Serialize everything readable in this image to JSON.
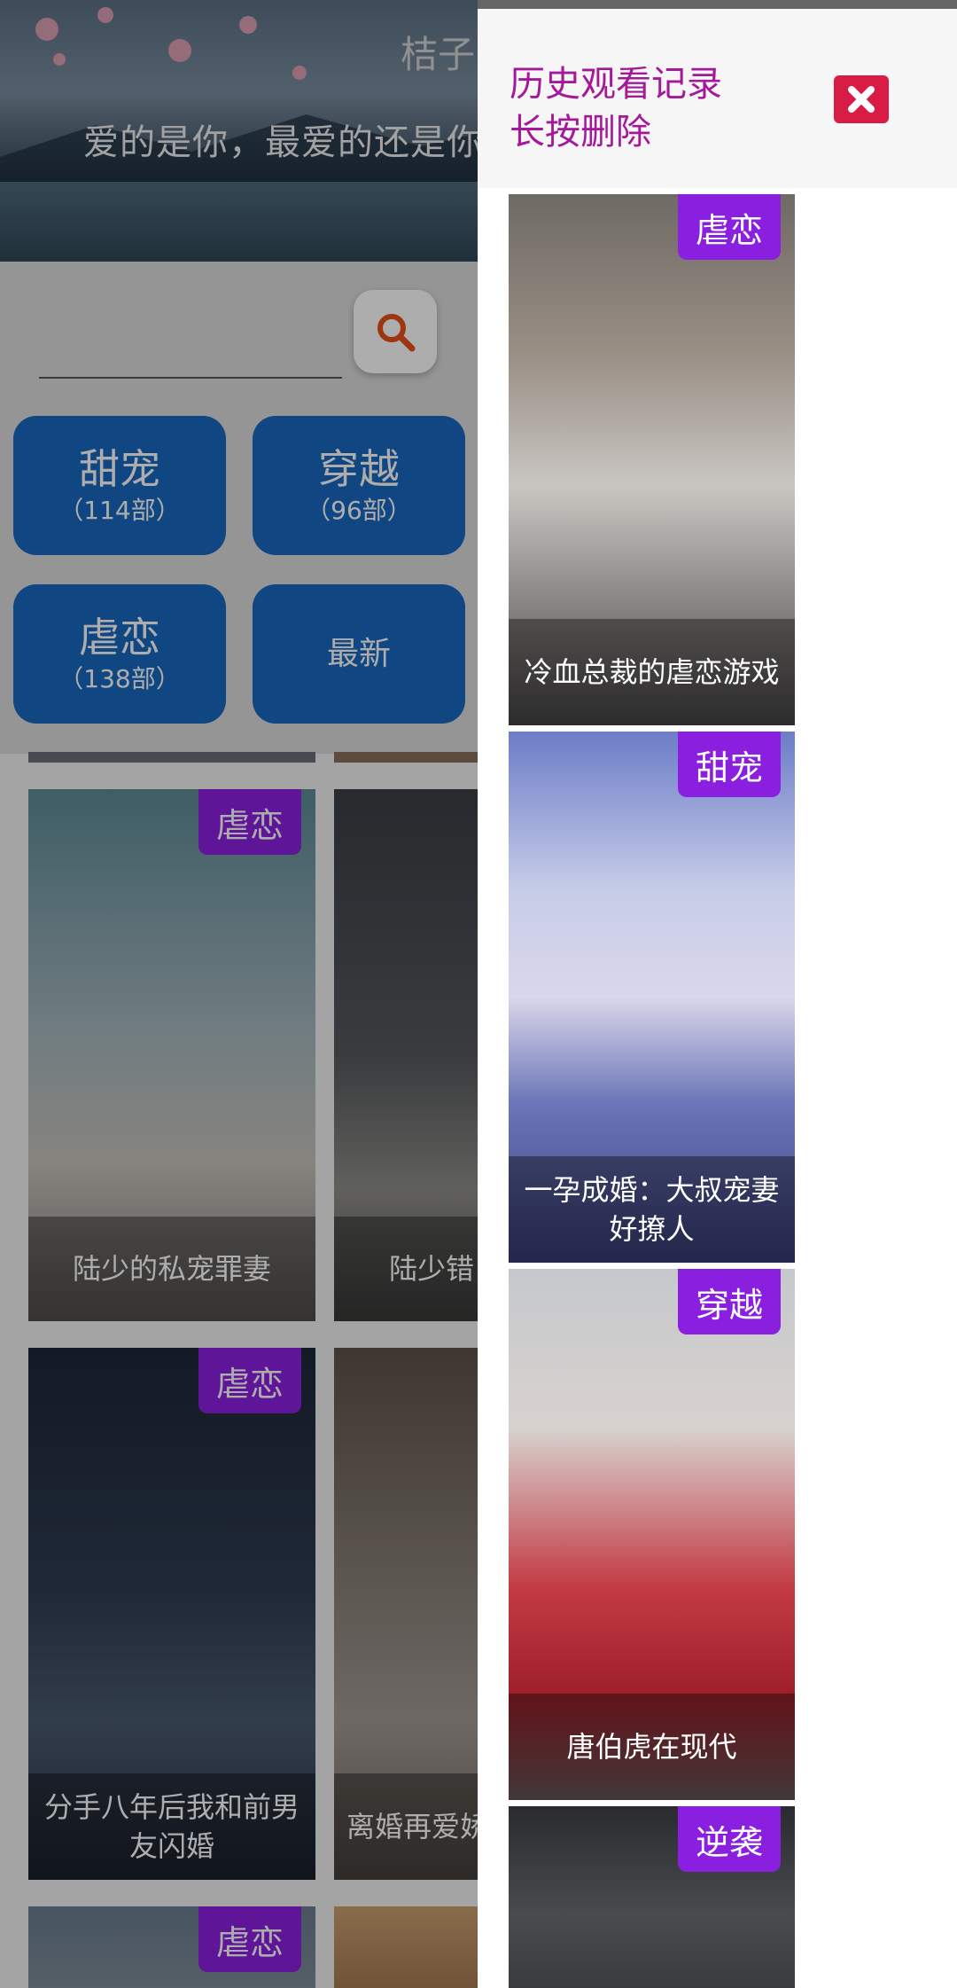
{
  "banner": {
    "title": "桔子",
    "quote": "爱的是你，最爱的还是你"
  },
  "categories": [
    {
      "name": "甜宠",
      "count": "（114部）"
    },
    {
      "name": "穿越",
      "count": "（96部）"
    },
    {
      "name": "虐恋",
      "count": "（138部）"
    },
    {
      "name": "最新",
      "count": ""
    }
  ],
  "grid": {
    "cards": [
      {
        "tag": "虐恋",
        "title": "陆少的私宠罪妻"
      },
      {
        "tag": "",
        "title": "陆少错"
      },
      {
        "tag": "虐恋",
        "title": "分手八年后我和前男友闪婚"
      },
      {
        "tag": "",
        "title": "离婚再爱娇"
      },
      {
        "tag": "虐恋",
        "title": ""
      }
    ]
  },
  "drawer": {
    "title_line1": "历史观看记录",
    "title_line2": "长按删除",
    "history": [
      {
        "tag": "虐恋",
        "title": "冷血总裁的虐恋游戏"
      },
      {
        "tag": "甜宠",
        "title": "一孕成婚：大叔宠妻好撩人"
      },
      {
        "tag": "穿越",
        "title": "唐伯虎在现代"
      },
      {
        "tag": "逆袭",
        "title": ""
      }
    ]
  },
  "colors": {
    "category_bg": "#1967c0",
    "badge_bg": "#8b1fe0",
    "drawer_title": "#a3199a",
    "close_bg": "#d81c45",
    "search_icon": "#e8501a"
  },
  "icons": {
    "search": "search-icon",
    "close": "close-icon"
  }
}
